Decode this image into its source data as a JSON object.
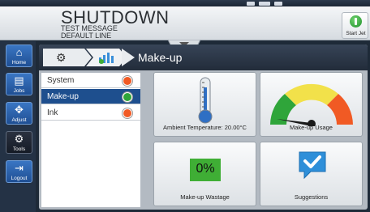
{
  "header": {
    "printer_state": "SHUTDOWN",
    "message_name": "TEST MESSAGE",
    "line_name": "DEFAULT LINE",
    "start_label": "Start Jet"
  },
  "nav": [
    {
      "label": "Home",
      "icon": "home-icon"
    },
    {
      "label": "Jobs",
      "icon": "jobs-icon"
    },
    {
      "label": "Adjust",
      "icon": "adjust-icon"
    },
    {
      "label": "Tools",
      "icon": "gear-icon"
    },
    {
      "label": "Logout",
      "icon": "logout-icon"
    }
  ],
  "breadcrumb": {
    "title": "Make-up"
  },
  "list": [
    {
      "label": "System",
      "status_color": "#f15a24"
    },
    {
      "label": "Make-up",
      "status_color": "#2fa53a"
    },
    {
      "label": "Ink",
      "status_color": "#f15a24"
    }
  ],
  "tiles": {
    "ambient": {
      "label": "Ambient Temperature: 20.00°C"
    },
    "usage": {
      "label": "Make-up Usage",
      "needle_fraction": 0.08
    },
    "wastage": {
      "label": "Make-up Wastage",
      "value": "0%"
    },
    "suggestions": {
      "label": "Suggestions"
    }
  },
  "colors": {
    "accent": "#1e4f8e",
    "good": "#2fa53a",
    "warn": "#f15a24",
    "gauge_yellow": "#f2e14a"
  }
}
